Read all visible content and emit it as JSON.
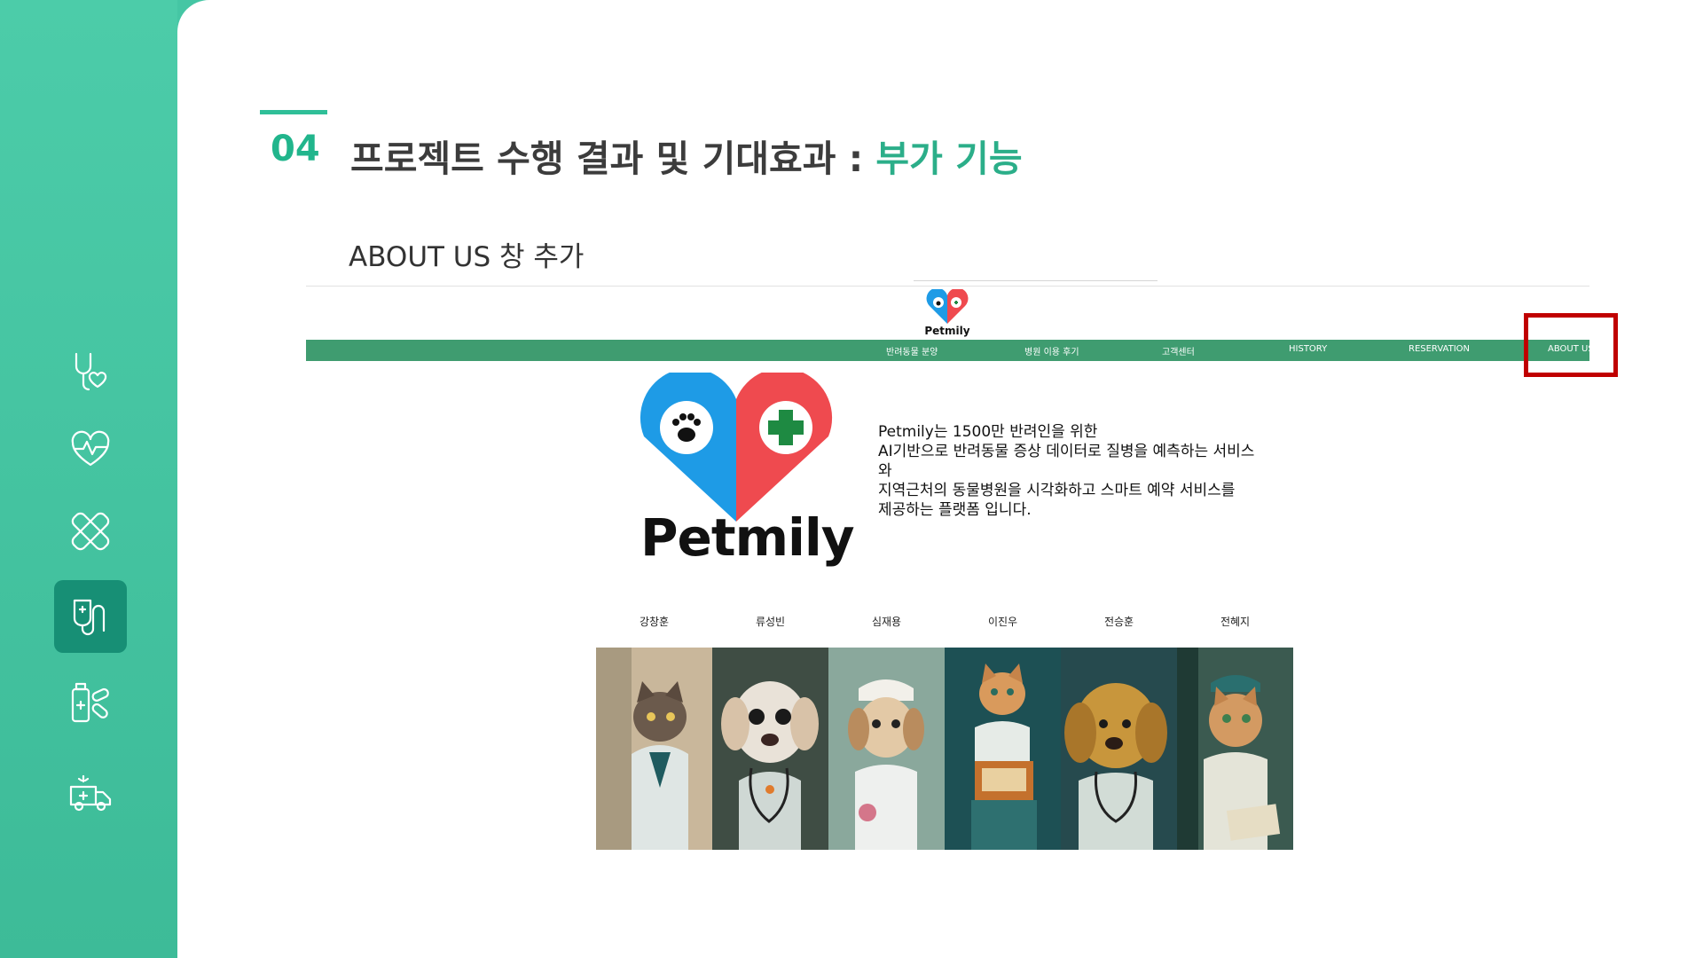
{
  "slide": {
    "number": "04",
    "title_main": "프로젝트 수행 결과 및 기대효과 : ",
    "title_accent": "부가 기능",
    "subtitle": "ABOUT US 창 추가"
  },
  "sidebar": {
    "items": [
      {
        "icon": "stethoscope-heart-icon"
      },
      {
        "icon": "heartbeat-icon"
      },
      {
        "icon": "bandage-icon"
      },
      {
        "icon": "iv-stethoscope-icon",
        "active": true
      },
      {
        "icon": "medicine-pills-icon"
      },
      {
        "icon": "ambulance-icon"
      }
    ]
  },
  "website": {
    "logo_text": "Petmily",
    "nav": [
      "반려동물 분양",
      "병원 이용 후기",
      "고객센터",
      "HISTORY",
      "RESERVATION",
      "ABOUT US"
    ],
    "about_logo_text": "Petmily",
    "description_lines": [
      "Petmily는 1500만 반려인을 위한",
      "AI기반으로 반려동물 증상 데이터로 질병을 예측하는 서비스",
      "와",
      "지역근처의 동물병원을 시각화하고 스마트 예약 서비스를",
      "제공하는 플랫폼 입니다."
    ],
    "team": [
      "강창훈",
      "류성빈",
      "심재용",
      "이진우",
      "전승훈",
      "전혜지"
    ]
  },
  "colors": {
    "sidebar": "#45c6a4",
    "active_icon_bg": "#178f75",
    "title_accent": "#2bae89",
    "navbar": "#3f9c70",
    "highlight": "#c00000",
    "logo_blue": "#1e9be6",
    "logo_red": "#ef4a4f",
    "logo_green": "#1e8a42"
  }
}
